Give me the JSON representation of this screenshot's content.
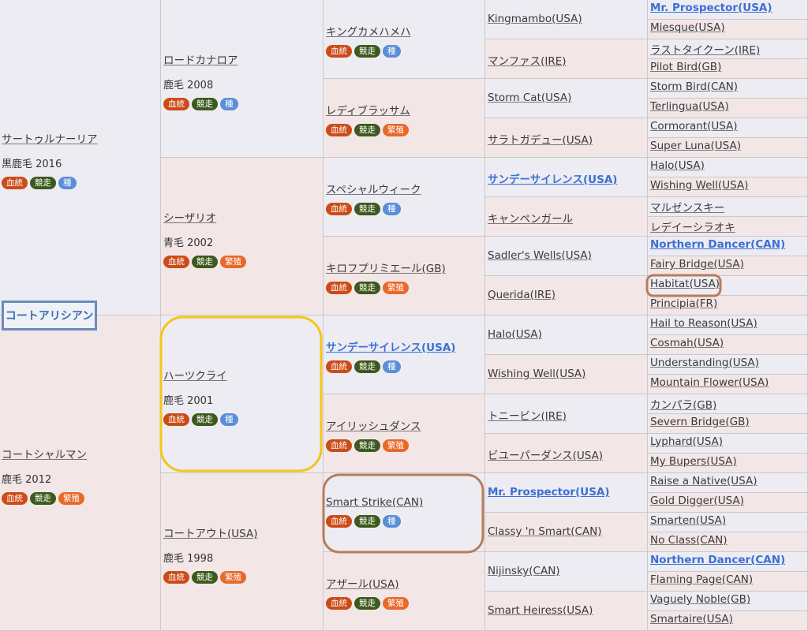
{
  "subject": {
    "name": "コートアリシアン"
  },
  "gen1": [
    {
      "name": "サートゥルナーリア",
      "color_year": "黒鹿毛 2016",
      "badges": [
        "血統",
        "競走",
        "種"
      ],
      "sex": "m"
    },
    {
      "name": "コートシャルマン",
      "color_year": "鹿毛 2012",
      "badges": [
        "血統",
        "競走",
        "繁殖"
      ],
      "sex": "f"
    }
  ],
  "gen2": [
    {
      "name": "ロードカナロア",
      "color_year": "鹿毛 2008",
      "badges": [
        "血統",
        "競走",
        "種"
      ],
      "sex": "m"
    },
    {
      "name": "シーザリオ",
      "color_year": "青毛 2002",
      "badges": [
        "血統",
        "競走",
        "繁殖"
      ],
      "sex": "f"
    },
    {
      "name": "ハーツクライ",
      "color_year": "鹿毛 2001",
      "badges": [
        "血統",
        "競走",
        "種"
      ],
      "sex": "m"
    },
    {
      "name": "コートアウト(USA)",
      "color_year": "鹿毛 1998",
      "badges": [
        "血統",
        "競走",
        "繁殖"
      ],
      "sex": "f"
    }
  ],
  "gen3": [
    {
      "name": "キングカメハメハ",
      "badges": [
        "血統",
        "競走",
        "種"
      ],
      "sex": "m"
    },
    {
      "name": "レディブラッサム",
      "badges": [
        "血統",
        "競走",
        "繁殖"
      ],
      "sex": "f"
    },
    {
      "name": "スペシャルウィーク",
      "badges": [
        "血統",
        "競走",
        "種"
      ],
      "sex": "m"
    },
    {
      "name": "キロフプリミエール(GB)",
      "badges": [
        "血統",
        "競走",
        "繁殖"
      ],
      "sex": "f"
    },
    {
      "name": "サンデーサイレンス(USA)",
      "badges": [
        "血統",
        "競走",
        "種"
      ],
      "sex": "m",
      "strong": true
    },
    {
      "name": "アイリッシュダンス",
      "badges": [
        "血統",
        "競走",
        "繁殖"
      ],
      "sex": "f"
    },
    {
      "name": "Smart Strike(CAN)",
      "badges": [
        "血統",
        "競走",
        "種"
      ],
      "sex": "m"
    },
    {
      "name": "アザール(USA)",
      "badges": [
        "血統",
        "競走",
        "繁殖"
      ],
      "sex": "f"
    }
  ],
  "gen4": [
    {
      "name": "Kingmambo(USA)",
      "sex": "m"
    },
    {
      "name": "マンファス(IRE)",
      "sex": "f"
    },
    {
      "name": "Storm Cat(USA)",
      "sex": "m"
    },
    {
      "name": "サラトガデュー(USA)",
      "sex": "f"
    },
    {
      "name": "サンデーサイレンス(USA)",
      "sex": "m",
      "strong": true
    },
    {
      "name": "キャンペンガール",
      "sex": "f"
    },
    {
      "name": "Sadler's Wells(USA)",
      "sex": "m"
    },
    {
      "name": "Querida(IRE)",
      "sex": "f"
    },
    {
      "name": "Halo(USA)",
      "sex": "m"
    },
    {
      "name": "Wishing Well(USA)",
      "sex": "f"
    },
    {
      "name": "トニービン(IRE)",
      "sex": "m"
    },
    {
      "name": "ビユーパーダンス(USA)",
      "sex": "f"
    },
    {
      "name": "Mr. Prospector(USA)",
      "sex": "m",
      "strong": true
    },
    {
      "name": "Classy 'n Smart(CAN)",
      "sex": "f"
    },
    {
      "name": "Nijinsky(CAN)",
      "sex": "m"
    },
    {
      "name": "Smart Heiress(USA)",
      "sex": "f"
    }
  ],
  "gen5": [
    {
      "name": "Mr. Prospector(USA)",
      "sex": "m",
      "strong": true
    },
    {
      "name": "Miesque(USA)",
      "sex": "f"
    },
    {
      "name": "ラストタイクーン(IRE)",
      "sex": "m"
    },
    {
      "name": "Pilot Bird(GB)",
      "sex": "f"
    },
    {
      "name": "Storm Bird(CAN)",
      "sex": "m"
    },
    {
      "name": "Terlingua(USA)",
      "sex": "f"
    },
    {
      "name": "Cormorant(USA)",
      "sex": "m"
    },
    {
      "name": "Super Luna(USA)",
      "sex": "f"
    },
    {
      "name": "Halo(USA)",
      "sex": "m"
    },
    {
      "name": "Wishing Well(USA)",
      "sex": "f"
    },
    {
      "name": "マルゼンスキー",
      "sex": "m"
    },
    {
      "name": "レデイーシラオキ",
      "sex": "f"
    },
    {
      "name": "Northern Dancer(CAN)",
      "sex": "m",
      "strong": true
    },
    {
      "name": "Fairy Bridge(USA)",
      "sex": "f"
    },
    {
      "name": "Habitat(USA)",
      "sex": "m"
    },
    {
      "name": "Principia(FR)",
      "sex": "f"
    },
    {
      "name": "Hail to Reason(USA)",
      "sex": "m"
    },
    {
      "name": "Cosmah(USA)",
      "sex": "f"
    },
    {
      "name": "Understanding(USA)",
      "sex": "m"
    },
    {
      "name": "Mountain Flower(USA)",
      "sex": "f"
    },
    {
      "name": "カンパラ(GB)",
      "sex": "m"
    },
    {
      "name": "Severn Bridge(GB)",
      "sex": "f"
    },
    {
      "name": "Lyphard(USA)",
      "sex": "m"
    },
    {
      "name": "My Bupers(USA)",
      "sex": "f"
    },
    {
      "name": "Raise a Native(USA)",
      "sex": "m"
    },
    {
      "name": "Gold Digger(USA)",
      "sex": "f"
    },
    {
      "name": "Smarten(USA)",
      "sex": "m"
    },
    {
      "name": "No Class(CAN)",
      "sex": "f"
    },
    {
      "name": "Northern Dancer(CAN)",
      "sex": "m",
      "strong": true
    },
    {
      "name": "Flaming Page(CAN)",
      "sex": "f"
    },
    {
      "name": "Vaguely Noble(GB)",
      "sex": "m"
    },
    {
      "name": "Smartaire(USA)",
      "sex": "f"
    }
  ],
  "colors": {
    "male_bg": "#edecf2",
    "female_bg": "#f3e6e6",
    "link_strong": "#3b6fd6",
    "badge_blood": "#cc4b17",
    "badge_race": "#3d5a1e",
    "badge_sire": "#5a8ed8",
    "badge_dam": "#e8692a",
    "highlight_yellow": "#f5c518",
    "highlight_brown": "#b87c5a",
    "subject_border": "#6a8bbd"
  }
}
